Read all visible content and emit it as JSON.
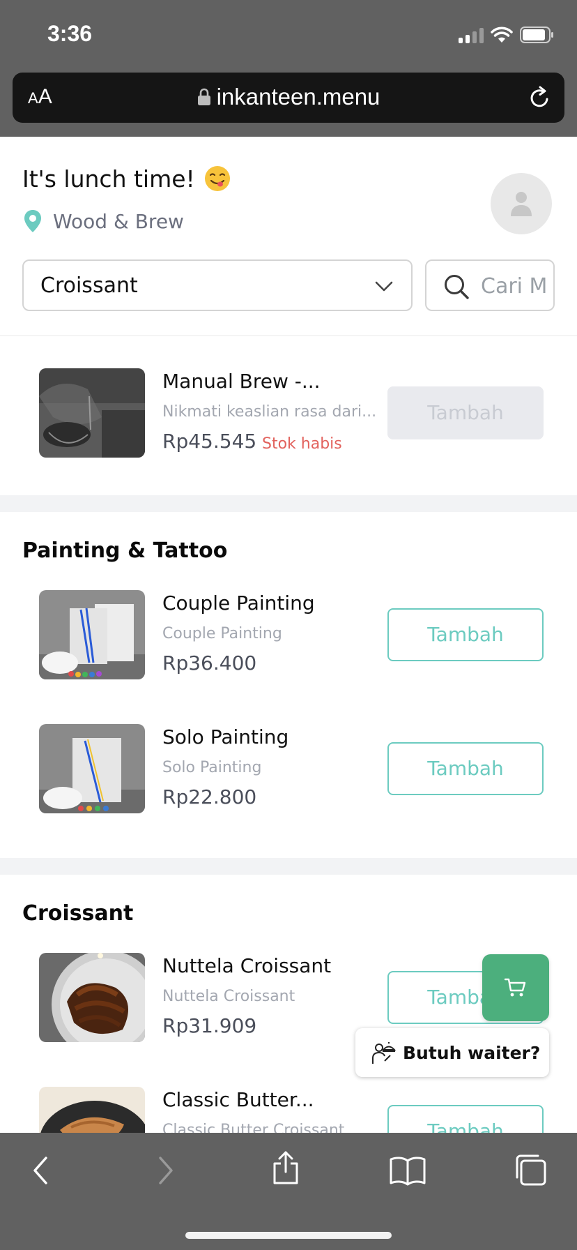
{
  "status_bar": {
    "time": "3:36"
  },
  "browser": {
    "text_size_label": "AA",
    "url": "inkanteen.menu"
  },
  "header": {
    "greeting": "It's lunch time!",
    "location": "Wood & Brew",
    "category_selected": "Croissant",
    "search_placeholder": "Cari Menu"
  },
  "top_item": {
    "name": "Manual Brew -...",
    "description": "Nikmati keaslian rasa dari...",
    "price": "Rp45.545",
    "stock_status": "Stok habis",
    "add_label": "Tambah"
  },
  "sections": [
    {
      "title": "Painting & Tattoo",
      "items": [
        {
          "name": "Couple Painting",
          "description": "Couple Painting",
          "price": "Rp36.400",
          "add_label": "Tambah"
        },
        {
          "name": "Solo Painting",
          "description": "Solo Painting",
          "price": "Rp22.800",
          "add_label": "Tambah"
        }
      ]
    },
    {
      "title": "Croissant",
      "items": [
        {
          "name": "Nuttela Croissant",
          "description": "Nuttela Croissant",
          "price": "Rp31.909",
          "add_label": "Tambah"
        },
        {
          "name": "Classic Butter...",
          "description": "Classic Butter Croissant",
          "add_label": "Tambah"
        }
      ]
    }
  ],
  "floating": {
    "waiter_label": "Butuh waiter?"
  },
  "colors": {
    "accent": "#6ccbc0",
    "cart": "#4caf7d",
    "out_of_stock": "#e2625d",
    "chrome": "#616161"
  }
}
